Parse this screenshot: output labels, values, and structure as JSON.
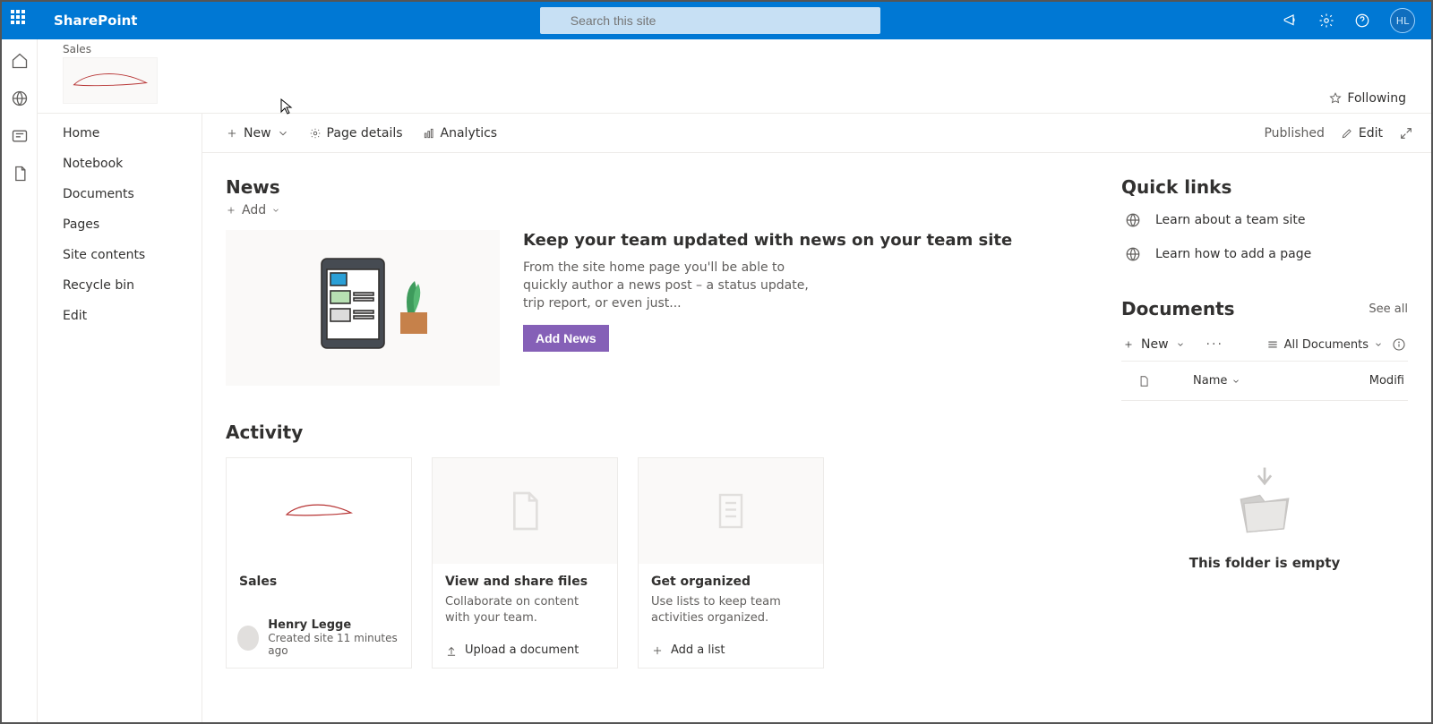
{
  "suite": {
    "brand": "SharePoint",
    "search_placeholder": "Search this site",
    "avatar_initials": "HL"
  },
  "site": {
    "breadcrumb": "Sales",
    "following_label": "Following"
  },
  "left_nav": {
    "items": [
      "Home",
      "Notebook",
      "Documents",
      "Pages",
      "Site contents",
      "Recycle bin",
      "Edit"
    ]
  },
  "cmdbar": {
    "new_label": "New",
    "page_details": "Page details",
    "analytics": "Analytics",
    "published": "Published",
    "edit": "Edit"
  },
  "news": {
    "heading": "News",
    "add": "Add",
    "title": "Keep your team updated with news on your team site",
    "body": "From the site home page you'll be able to quickly author a news post – a status update, trip report, or even just...",
    "button": "Add News"
  },
  "activity": {
    "heading": "Activity",
    "cards": [
      {
        "title": "Sales",
        "user_name": "Henry Legge",
        "user_sub": "Created site 11 minutes ago"
      },
      {
        "title": "View and share files",
        "desc": "Collaborate on content with your team.",
        "action": "Upload a document"
      },
      {
        "title": "Get organized",
        "desc": "Use lists to keep team activities organized.",
        "action": "Add a list"
      }
    ]
  },
  "quicklinks": {
    "heading": "Quick links",
    "items": [
      "Learn about a team site",
      "Learn how to add a page"
    ]
  },
  "documents": {
    "heading": "Documents",
    "see_all": "See all",
    "new_label": "New",
    "view_label": "All Documents",
    "col_name": "Name",
    "col_modified": "Modifi",
    "empty": "This folder is empty"
  }
}
